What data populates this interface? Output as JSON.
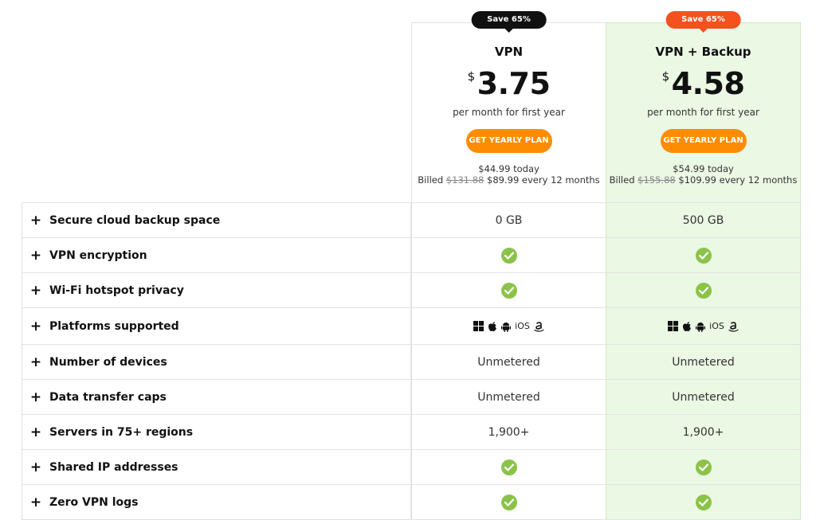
{
  "plans": [
    {
      "badge": "Save 65%",
      "name": "VPN",
      "currency": "$",
      "price": "3.75",
      "per": "per month for first year",
      "cta": "GET YEARLY PLAN",
      "today": "$44.99 today",
      "billed_prefix": "Billed",
      "billed_old": "$131.88",
      "billed_new": "$89.99 every 12 months"
    },
    {
      "badge": "Save 65%",
      "name": "VPN + Backup",
      "currency": "$",
      "price": "4.58",
      "per": "per month for first year",
      "cta": "GET YEARLY PLAN",
      "today": "$54.99 today",
      "billed_prefix": "Billed",
      "billed_old": "$155.88",
      "billed_new": "$109.99 every 12 months"
    }
  ],
  "features": [
    {
      "label": "Secure cloud backup space",
      "vpn": "0 GB",
      "backup": "500 GB"
    },
    {
      "label": "VPN encryption",
      "vpn": "check",
      "backup": "check"
    },
    {
      "label": "Wi-Fi hotspot privacy",
      "vpn": "check",
      "backup": "check"
    },
    {
      "label": "Platforms supported",
      "vpn": "platforms",
      "backup": "platforms"
    },
    {
      "label": "Number of devices",
      "vpn": "Unmetered",
      "backup": "Unmetered"
    },
    {
      "label": "Data transfer caps",
      "vpn": "Unmetered",
      "backup": "Unmetered"
    },
    {
      "label": "Servers in 75+ regions",
      "vpn": "1,900+",
      "backup": "1,900+"
    },
    {
      "label": "Shared IP addresses",
      "vpn": "check",
      "backup": "check"
    },
    {
      "label": "Zero VPN logs",
      "vpn": "check",
      "backup": "check"
    }
  ],
  "platform_icons": [
    "windows-icon",
    "apple-icon",
    "android-icon",
    "ios-icon",
    "amazon-icon"
  ],
  "ios_label": "iOS",
  "plus_symbol": "+",
  "colors": {
    "accent": "#ff8c00",
    "badge_dark": "#111111",
    "badge_red": "#f4511e",
    "check": "#8bc34a",
    "highlight_bg": "#eaf8e4"
  }
}
